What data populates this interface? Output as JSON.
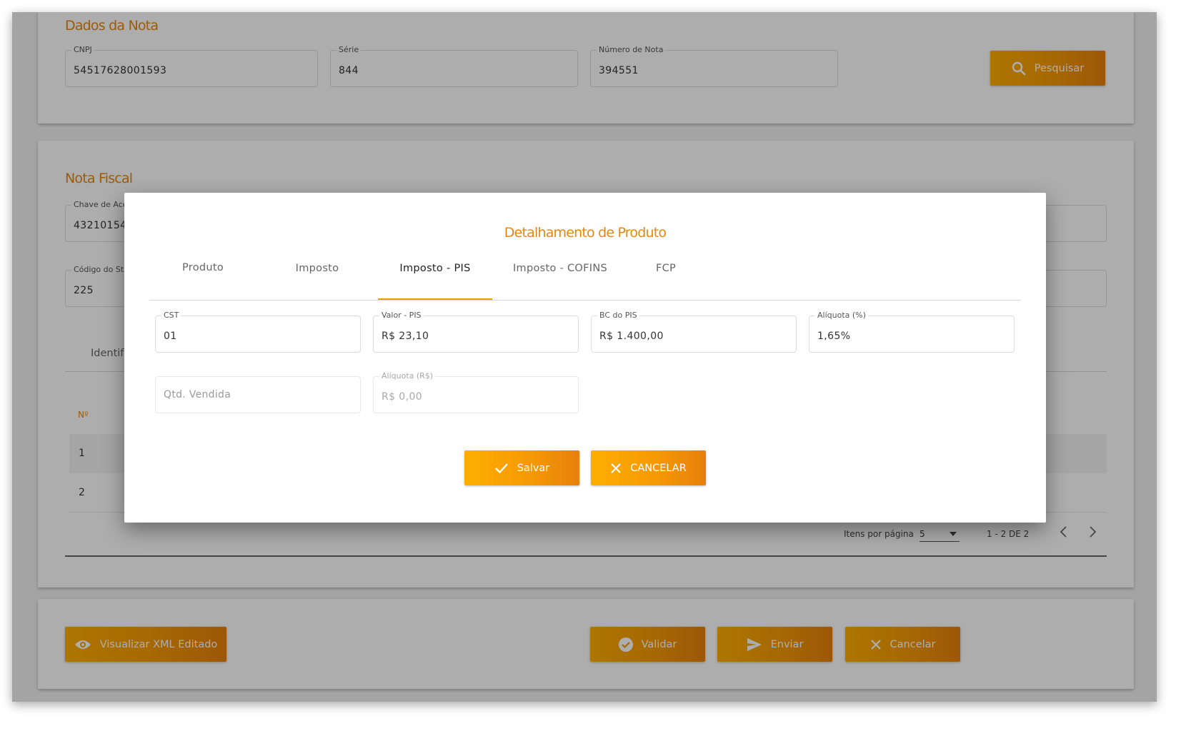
{
  "dados_nota": {
    "title": "Dados da Nota",
    "cnpj": {
      "label": "CNPJ",
      "value": "54517628001593"
    },
    "serie": {
      "label": "Série",
      "value": "844"
    },
    "numero": {
      "label": "Número de Nota",
      "value": "394551"
    },
    "search_label": "Pesquisar"
  },
  "nota_fiscal": {
    "title": "Nota Fiscal",
    "chave_label": "Chave de Ace",
    "chave_value": "43210154",
    "codigo_label": "Código do Sta",
    "codigo_value": "225",
    "tab_identif": "Identif",
    "col_no": "Nº",
    "rows": [
      "1",
      "2"
    ],
    "pagination": {
      "items_label": "Itens por página",
      "page_size": "5",
      "range": "1 - 2 DE 2"
    }
  },
  "actions": {
    "view_xml": "Visualizar XML Editado",
    "validate": "Validar",
    "send": "Enviar",
    "cancel": "Cancelar"
  },
  "modal": {
    "title": "Detalhamento de Produto",
    "tabs": [
      "Produto",
      "Imposto",
      "Imposto - PIS",
      "Imposto - COFINS",
      "FCP"
    ],
    "active_tab": "Imposto - PIS",
    "fields": {
      "cst": {
        "label": "CST",
        "value": "01"
      },
      "valor_pis": {
        "label": "Valor - PIS",
        "value": "R$ 23,10"
      },
      "bc_pis": {
        "label": "BC do PIS",
        "value": "R$ 1.400,00"
      },
      "aliquota_pct": {
        "label": "Alíquota (%)",
        "value": "1,65%"
      },
      "qtd_vendida": {
        "placeholder": "Qtd. Vendida"
      },
      "aliquota_rs": {
        "label": "Alíquota (R$)",
        "value": "R$ 0,00"
      }
    },
    "save_label": "Salvar",
    "cancel_label": "CANCELAR"
  },
  "colors": {
    "accent": "#e8860b",
    "button_start": "#ffae00",
    "button_end": "#e8800b"
  }
}
